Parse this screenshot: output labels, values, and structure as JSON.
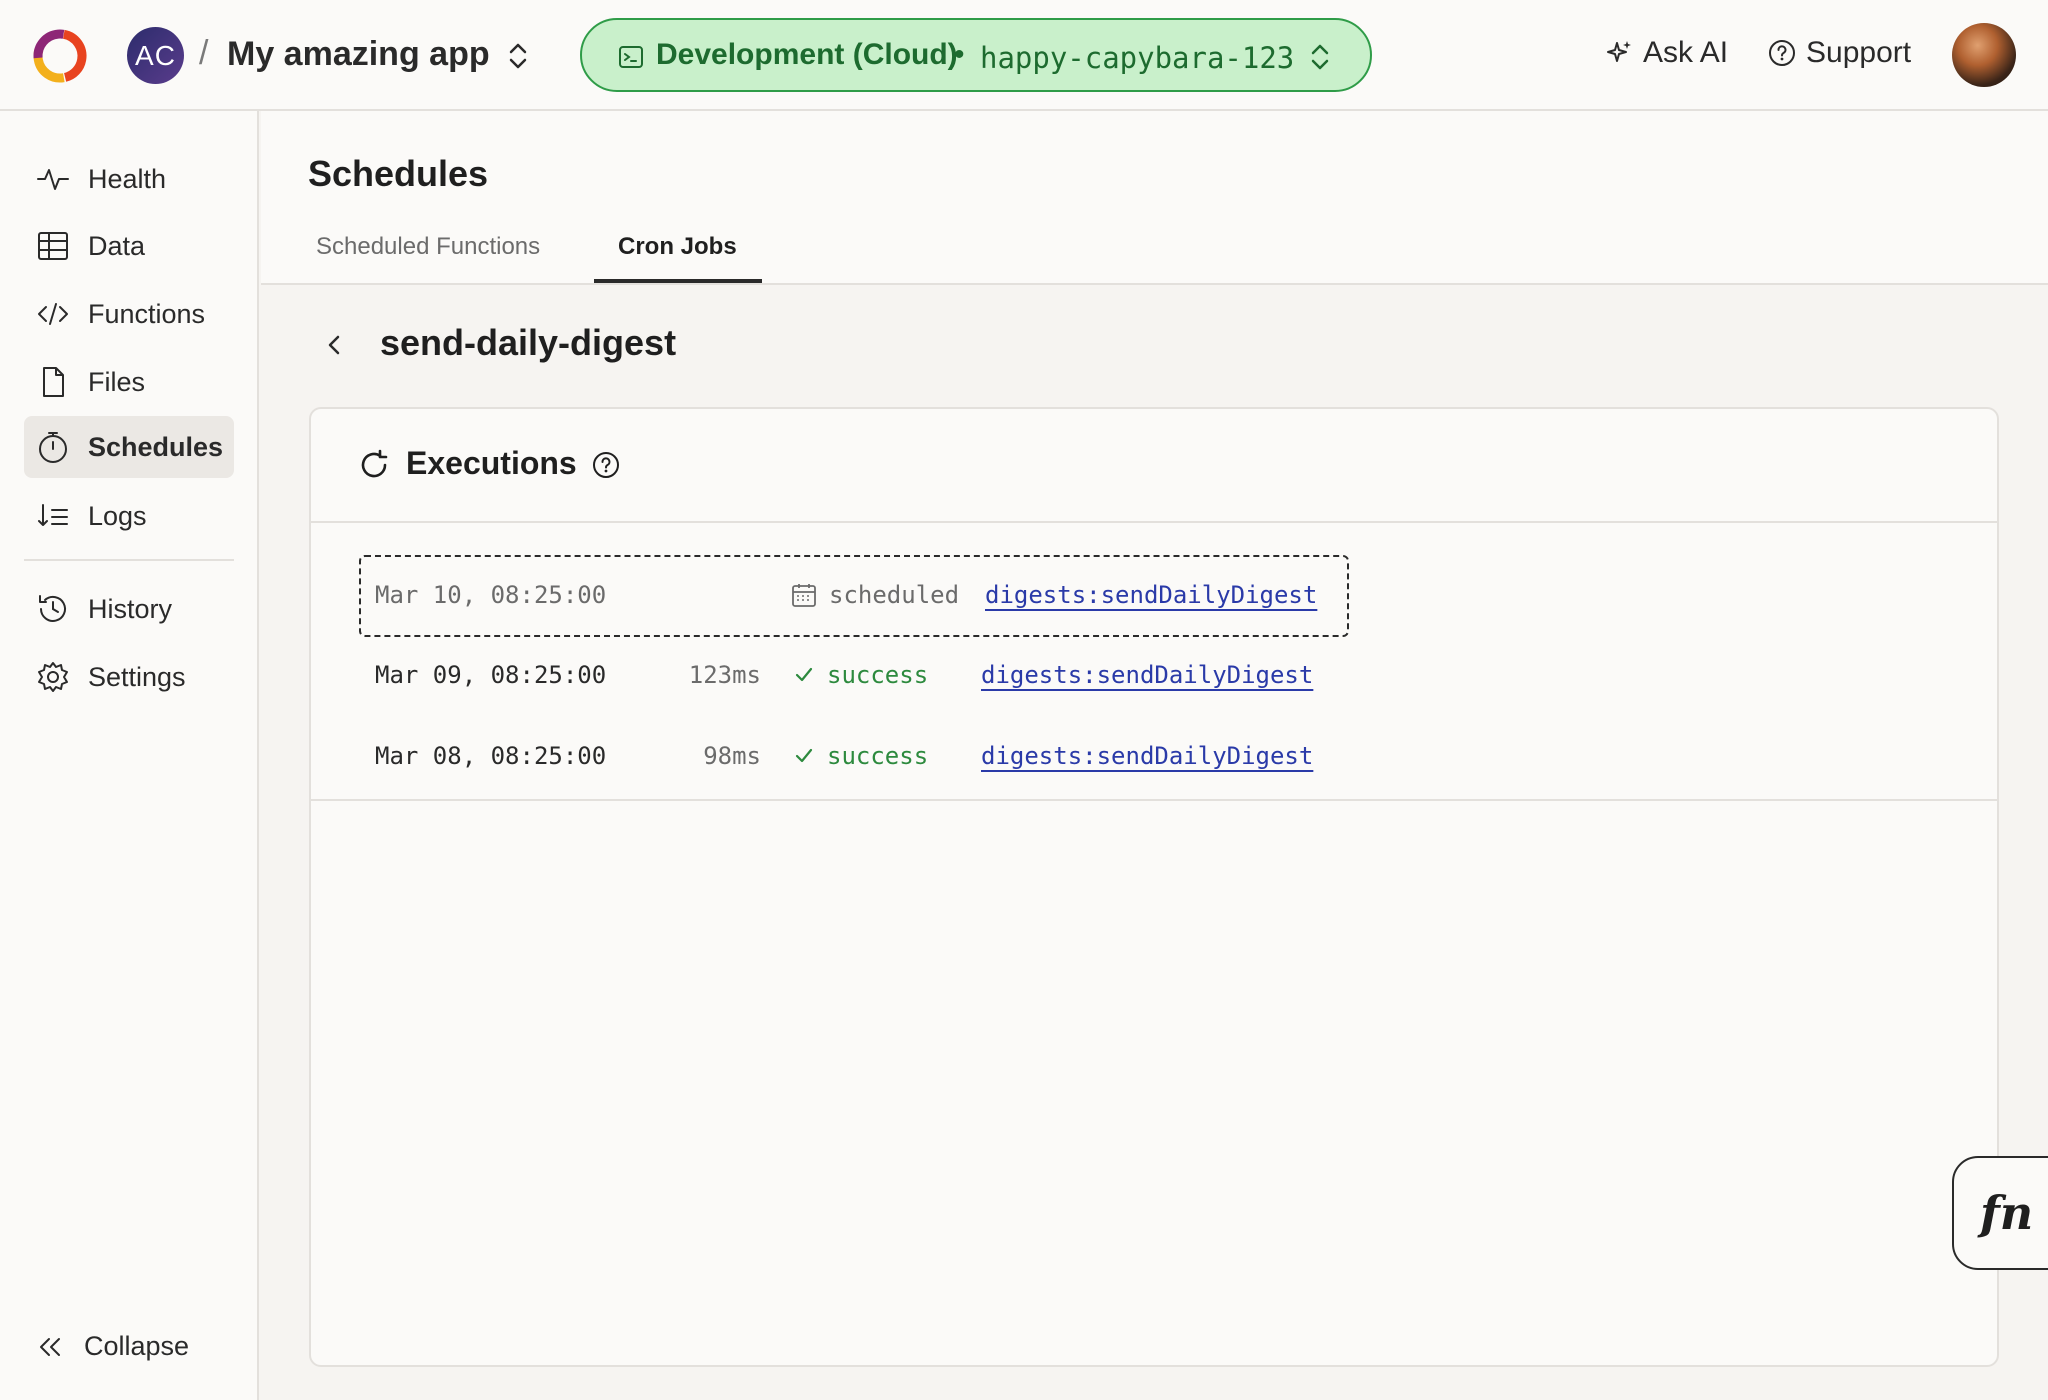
{
  "app": {
    "team_initials": "AC",
    "separator": "/",
    "project_name": "My amazing app"
  },
  "deployment": {
    "name": "Development (Cloud)",
    "dot": "•",
    "slug": "happy-capybara-123",
    "colors": {
      "border": "#2f9c48",
      "bg": "#c9f0cb",
      "text": "#1d6b2f"
    }
  },
  "topbar": {
    "ask_ai": "Ask AI",
    "support": "Support"
  },
  "sidebar": {
    "items": [
      {
        "label": "Health",
        "icon": "pulse-icon"
      },
      {
        "label": "Data",
        "icon": "table-icon"
      },
      {
        "label": "Functions",
        "icon": "code-icon"
      },
      {
        "label": "Files",
        "icon": "file-icon"
      },
      {
        "label": "Schedules",
        "icon": "stopwatch-icon",
        "active": true
      },
      {
        "label": "Logs",
        "icon": "sort-list-icon"
      },
      {
        "label": "History",
        "icon": "history-icon"
      },
      {
        "label": "Settings",
        "icon": "gear-icon"
      }
    ],
    "collapse": "Collapse"
  },
  "page": {
    "title": "Schedules",
    "tabs": [
      {
        "label": "Scheduled Functions",
        "active": false
      },
      {
        "label": "Cron Jobs",
        "active": true
      }
    ],
    "job_name": "send-daily-digest"
  },
  "executions": {
    "title": "Executions",
    "rows": [
      {
        "time": "Mar 10, 08:25:00",
        "duration": "",
        "status": "scheduled",
        "status_icon": "calendar-icon",
        "function": "digests:sendDailyDigest",
        "pending": true
      },
      {
        "time": "Mar 09, 08:25:00",
        "duration": "123ms",
        "status": "success",
        "status_icon": "check-icon",
        "function": "digests:sendDailyDigest",
        "pending": false
      },
      {
        "time": "Mar 08, 08:25:00",
        "duration": "98ms",
        "status": "success",
        "status_icon": "check-icon",
        "function": "digests:sendDailyDigest",
        "pending": false
      }
    ]
  },
  "fn_button": "fn"
}
